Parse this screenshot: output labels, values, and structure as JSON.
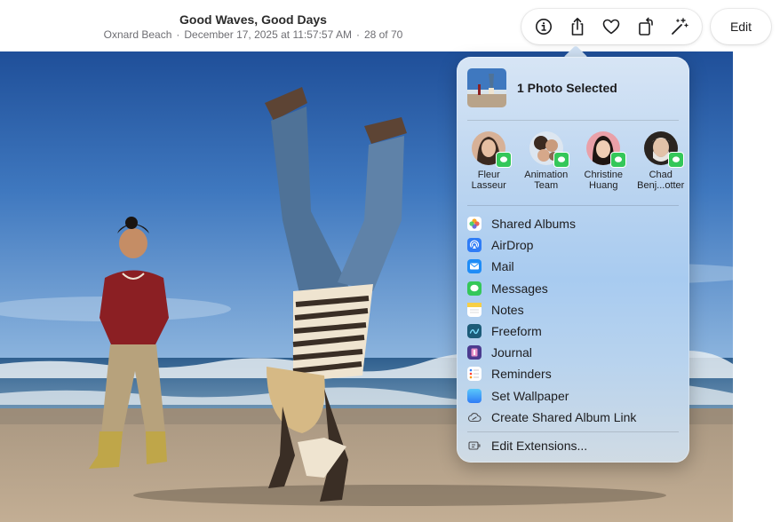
{
  "header": {
    "title": "Good Waves, Good Days",
    "location": "Oxnard Beach",
    "separator": "·",
    "datetime": "December 17, 2025 at 11:57:57 AM",
    "position": "28 of 70",
    "edit_label": "Edit"
  },
  "toolbar": {
    "icons": [
      "info-icon",
      "share-icon",
      "heart-icon",
      "rotate-icon",
      "magic-wand-icon"
    ]
  },
  "share": {
    "title": "1 Photo Selected",
    "people": [
      {
        "line1": "Fleur",
        "line2": "Lasseur"
      },
      {
        "line1": "Animation",
        "line2": "Team"
      },
      {
        "line1": "Christine",
        "line2": "Huang"
      },
      {
        "line1": "Chad",
        "line2": "Benj...otter"
      }
    ],
    "menu": [
      {
        "label": "Shared Albums",
        "icon": "photos-icon"
      },
      {
        "label": "AirDrop",
        "icon": "airdrop-icon"
      },
      {
        "label": "Mail",
        "icon": "mail-icon"
      },
      {
        "label": "Messages",
        "icon": "messages-icon"
      },
      {
        "label": "Notes",
        "icon": "notes-icon"
      },
      {
        "label": "Freeform",
        "icon": "freeform-icon"
      },
      {
        "label": "Journal",
        "icon": "journal-icon"
      },
      {
        "label": "Reminders",
        "icon": "reminders-icon"
      },
      {
        "label": "Set Wallpaper",
        "icon": "wallpaper-icon"
      },
      {
        "label": "Create Shared Album Link",
        "icon": "cloud-link-icon"
      }
    ],
    "edit_extensions": "Edit Extensions..."
  },
  "colors": {
    "accent_green": "#34c759",
    "sky_top": "#2a5fa8",
    "sand": "#b8a38a"
  }
}
